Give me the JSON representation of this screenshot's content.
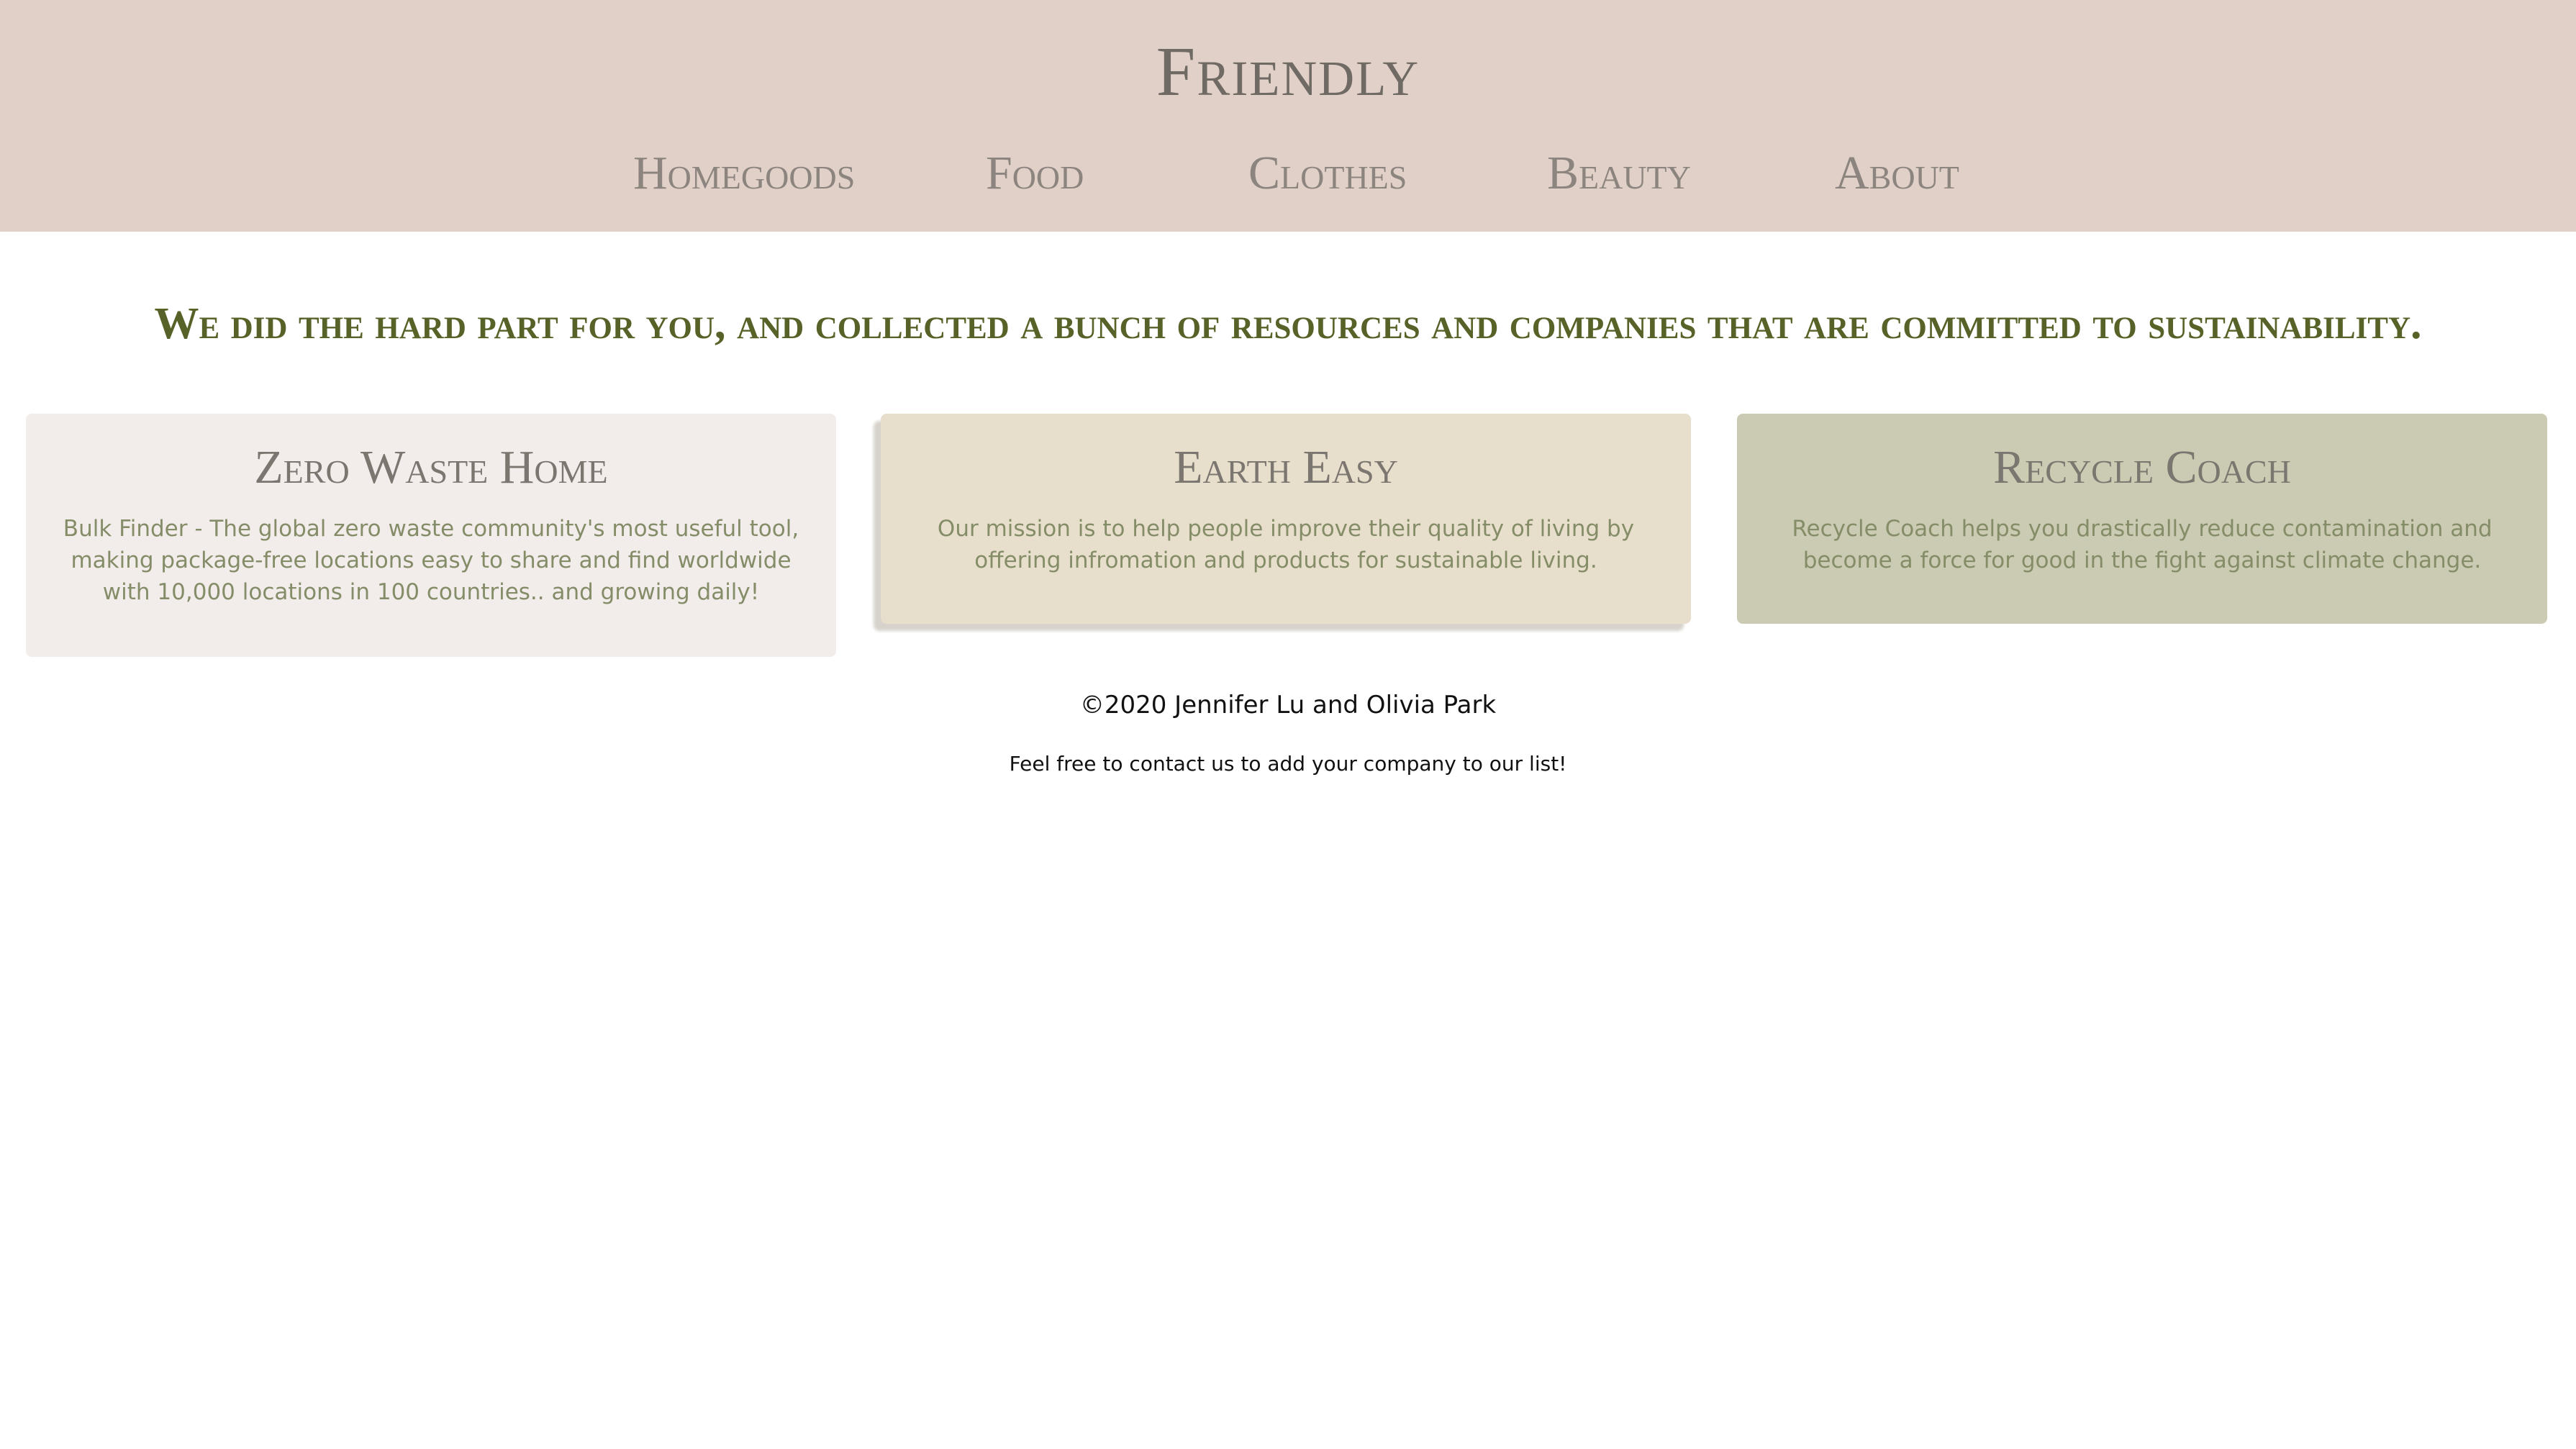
{
  "header": {
    "brand": "Friendly",
    "nav": [
      "Homegoods",
      "Food",
      "Clothes",
      "Beauty",
      "About"
    ],
    "background_color": "#e1d0c7"
  },
  "main": {
    "tagline": "We did the hard part for you, and collected a bunch of resources and companies that are committed to sustainability.",
    "cards": [
      {
        "title": "Zero Waste Home",
        "text": "Bulk Finder - The global zero waste community's most useful tool, making package-free locations easy to share and find worldwide with 10,000 locations in 100 countries.. and growing daily!",
        "background_color": "#f2eceb"
      },
      {
        "title": "Earth Easy",
        "text": "Our mission is to help people improve their quality of living by offering infromation and products for sustainable living.",
        "background_color": "#e7dfcc"
      },
      {
        "title": "Recycle Coach",
        "text": "Recycle Coach helps you drastically reduce contamination and become a force for good in the fight against climate change.",
        "background_color": "#cacbb2"
      }
    ]
  },
  "footer": {
    "copyright": "©2020 Jennifer Lu and Olivia Park",
    "contact": "Feel free to contact us to add your company to our list!"
  }
}
